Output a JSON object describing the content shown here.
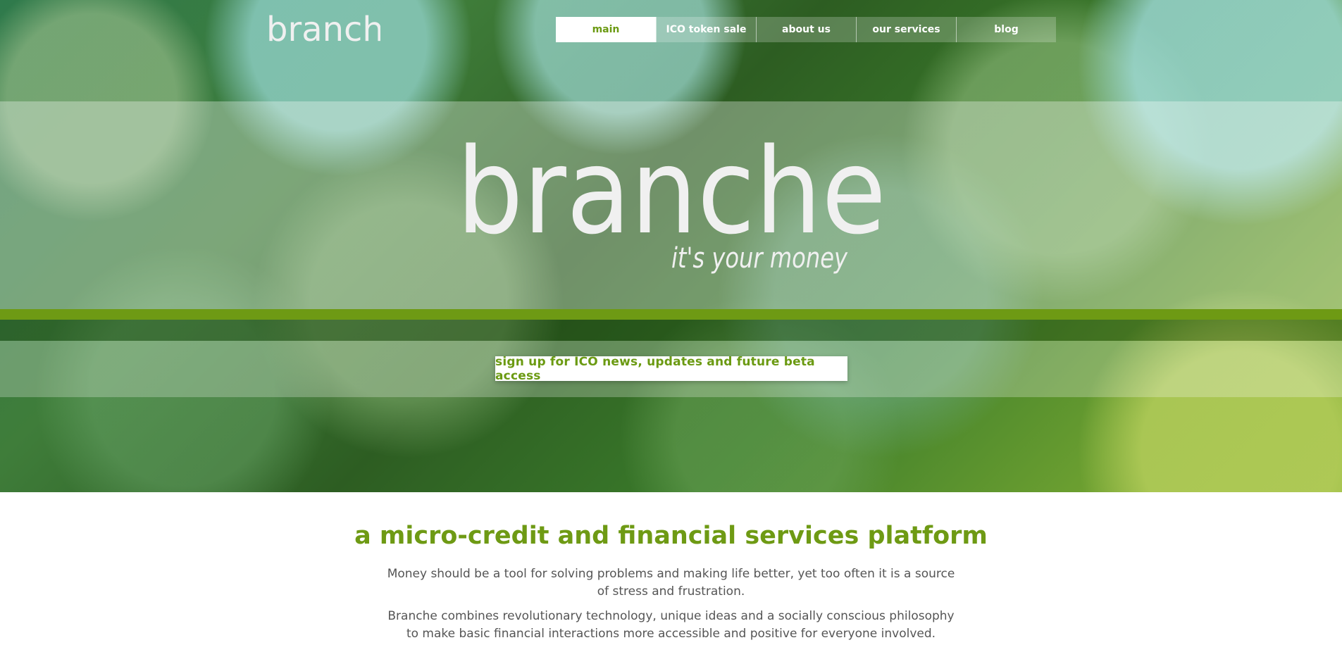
{
  "brand": {
    "name": "branche",
    "tagline": "it's your money"
  },
  "nav": {
    "items": [
      {
        "label": "main",
        "active": true
      },
      {
        "label": "ICO token sale",
        "active": false
      },
      {
        "label": "about us",
        "active": false
      },
      {
        "label": "our services",
        "active": false
      },
      {
        "label": "blog",
        "active": false
      }
    ]
  },
  "hero": {
    "signup_label": "sign up for ICO news, updates and future beta access"
  },
  "intro": {
    "heading": "a micro-credit and financial services platform",
    "paragraph1": "Money should be a tool for solving problems and making life better, yet too often it is a source of stress and frustration.",
    "paragraph2": "Branche combines revolutionary technology, unique ideas and a socially conscious philosophy to make basic financial interactions more accessible and positive for everyone involved."
  },
  "colors": {
    "accent": "#6e9a14",
    "text": "#555555",
    "white": "#ffffff"
  }
}
